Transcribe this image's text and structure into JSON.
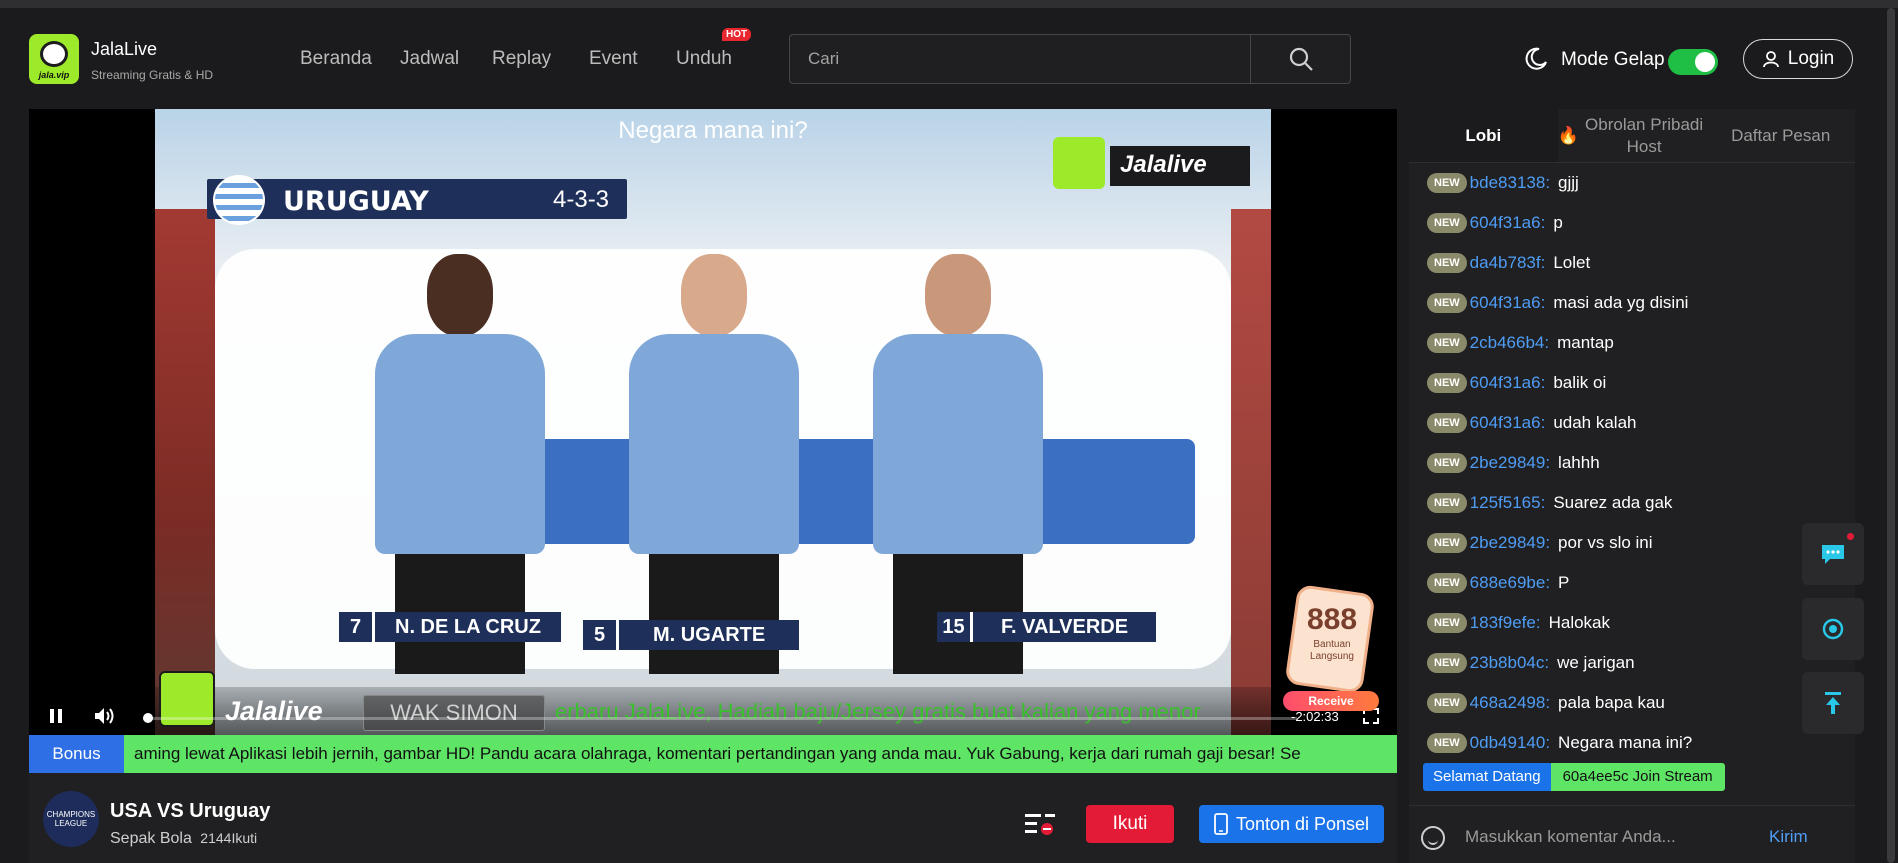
{
  "header": {
    "brand_name": "JalaLive",
    "brand_tagline": "Streaming Gratis & HD",
    "logo_domain": "jala.vip",
    "nav": [
      "Beranda",
      "Jadwal",
      "Replay",
      "Event",
      "Unduh"
    ],
    "hot_badge": "HOT",
    "search_placeholder": "Cari",
    "mode_label": "Mode Gelap",
    "dark_mode_on": true,
    "login_label": "Login"
  },
  "player": {
    "overlay_title": "Negara mana ini?",
    "team_name": "URUGUAY",
    "formation": "4-3-3",
    "watermark": "Jalalive",
    "players": [
      {
        "number": "7",
        "name": "N. DE LA CRUZ"
      },
      {
        "number": "5",
        "name": "M. UGARTE"
      },
      {
        "number": "15",
        "name": "F. VALVERDE"
      }
    ],
    "ticker_brand": "Jalalive",
    "ticker_sender": "WAK SIMON",
    "ticker_message": "erbaru JalaLive, Hadiah baju/Jersey gratis buat kalian yang menor",
    "time_remaining": "-2:02:33",
    "gift_number": "888",
    "gift_label": "Bantuan Langsung",
    "gift_button": "Receive"
  },
  "announcement": {
    "label": "Bonus",
    "message": "aming lewat Aplikasi lebih jernih, gambar HD! Pandu acara olahraga, komentari pertandingan yang anda mau. Yuk Gabung, kerja dari rumah gaji besar!          Se"
  },
  "match": {
    "title": "USA VS Uruguay",
    "category": "Sepak Bola",
    "followers": "2144Ikuti",
    "league_logo_text": "CHAMPIONS LEAGUE",
    "follow_label": "Ikuti",
    "watch_phone_label": "Tonton di Ponsel"
  },
  "chat": {
    "tabs": [
      "Lobi",
      "Obrolan Pribadi Host",
      "Daftar Pesan"
    ],
    "badge": "NEW",
    "messages": [
      {
        "user": "bde83138",
        "text": "gjjj"
      },
      {
        "user": "604f31a6",
        "text": "p"
      },
      {
        "user": "da4b783f",
        "text": "Lolet"
      },
      {
        "user": "604f31a6",
        "text": "masi ada yg disini"
      },
      {
        "user": "2cb466b4",
        "text": "mantap"
      },
      {
        "user": "604f31a6",
        "text": "balik oi"
      },
      {
        "user": "604f31a6",
        "text": "udah kalah"
      },
      {
        "user": "2be29849",
        "text": "lahhh"
      },
      {
        "user": "125f5165",
        "text": "Suarez ada gak"
      },
      {
        "user": "2be29849",
        "text": "por vs slo ini"
      },
      {
        "user": "688e69be",
        "text": "P"
      },
      {
        "user": "183f9efe",
        "text": "Halokak"
      },
      {
        "user": "23b8b04c",
        "text": "we jarigan"
      },
      {
        "user": "468a2498",
        "text": "pala  bapa kau"
      },
      {
        "user": "0db49140",
        "text": "Negara mana ini?"
      }
    ],
    "welcome_label": "Selamat Datang",
    "welcome_message": "60a4ee5c Join Stream",
    "input_placeholder": "Masukkan komentar Anda...",
    "send_label": "Kirim"
  },
  "colors": {
    "accent_green": "#9dea2a",
    "follow_red": "#e41b36",
    "primary_blue": "#1a73e8",
    "username_blue": "#4e9df5"
  }
}
